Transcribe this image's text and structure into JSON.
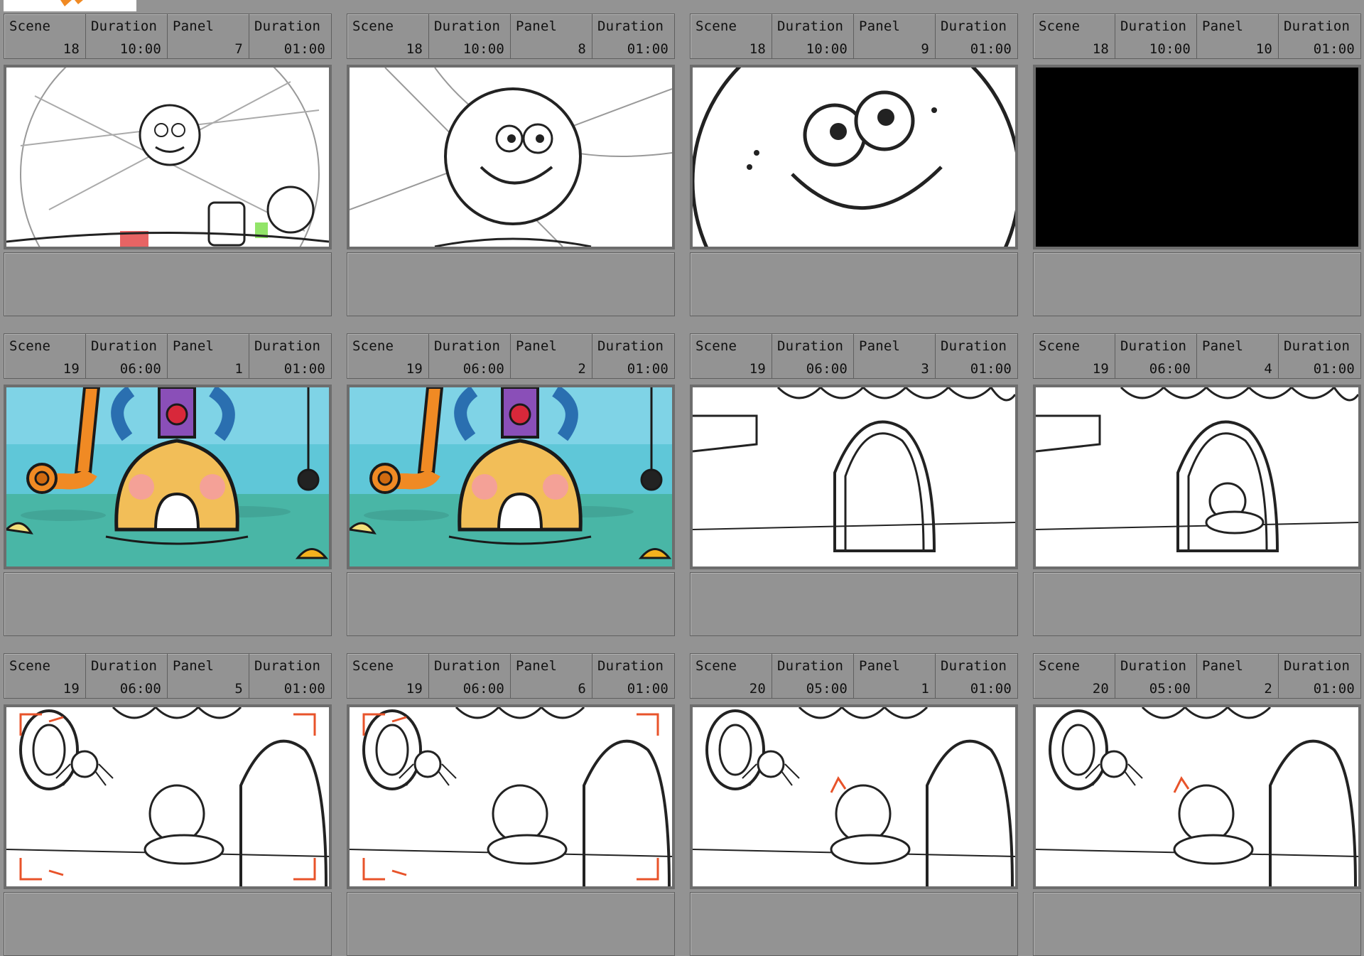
{
  "labels": {
    "scene": "Scene",
    "duration": "Duration",
    "panel": "Panel"
  },
  "panels": [
    {
      "scene": "18",
      "scene_duration": "10:00",
      "panel": "7",
      "panel_duration": "01:00",
      "art": "kid with jars, rough sketch",
      "fill": "sketch"
    },
    {
      "scene": "18",
      "scene_duration": "10:00",
      "panel": "8",
      "panel_duration": "01:00",
      "art": "kid closeup, sketch",
      "fill": "sketch"
    },
    {
      "scene": "18",
      "scene_duration": "10:00",
      "panel": "9",
      "panel_duration": "01:00",
      "art": "extreme closeup face, sketch",
      "fill": "sketch"
    },
    {
      "scene": "18",
      "scene_duration": "10:00",
      "panel": "10",
      "panel_duration": "01:00",
      "art": "black frame",
      "fill": "black"
    },
    {
      "scene": "19",
      "scene_duration": "06:00",
      "panel": "1",
      "panel_duration": "01:00",
      "art": "color house in water",
      "fill": "color"
    },
    {
      "scene": "19",
      "scene_duration": "06:00",
      "panel": "2",
      "panel_duration": "01:00",
      "art": "color house in water",
      "fill": "color"
    },
    {
      "scene": "19",
      "scene_duration": "06:00",
      "panel": "3",
      "panel_duration": "01:00",
      "art": "archway door sketch",
      "fill": "sketch"
    },
    {
      "scene": "19",
      "scene_duration": "06:00",
      "panel": "4",
      "panel_duration": "01:00",
      "art": "archway with pod sketch",
      "fill": "sketch"
    },
    {
      "scene": "19",
      "scene_duration": "06:00",
      "panel": "5",
      "panel_duration": "01:00",
      "art": "spider and pod, red camera marks",
      "fill": "sketch"
    },
    {
      "scene": "19",
      "scene_duration": "06:00",
      "panel": "6",
      "panel_duration": "01:00",
      "art": "spider and pod, red camera marks",
      "fill": "sketch"
    },
    {
      "scene": "20",
      "scene_duration": "05:00",
      "panel": "1",
      "panel_duration": "01:00",
      "art": "spider over kid in pod",
      "fill": "sketch"
    },
    {
      "scene": "20",
      "scene_duration": "05:00",
      "panel": "2",
      "panel_duration": "01:00",
      "art": "spider over kid in pod",
      "fill": "sketch"
    }
  ],
  "colors": {
    "background": "#939393",
    "border": "#5f5f5f",
    "frame_border": "#6d6d6d",
    "camera_mark": "#e8532a",
    "logo_star": "#f08a24"
  },
  "icons": {
    "logo": "studio-logo-star"
  }
}
